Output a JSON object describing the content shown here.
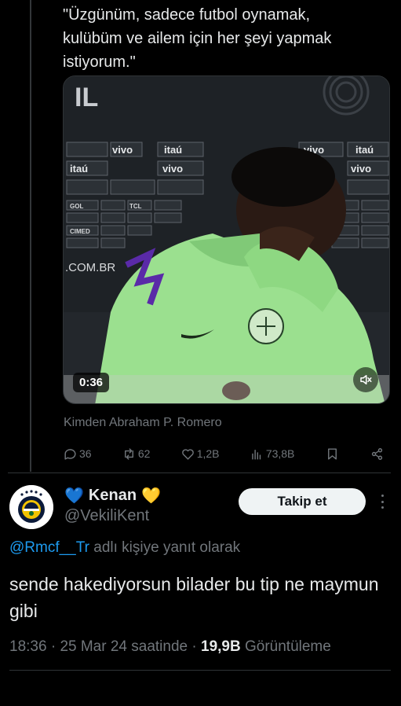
{
  "quoted": {
    "text": "\"Üzgünüm, sadece futbol oynamak,\nkulübüm ve ailem için her şeyi yapmak\nistiyorum.\"",
    "video": {
      "duration": "0:36",
      "backdrop_text": [
        "vivo",
        "itaú",
        "vivo",
        "itaú",
        "vivo",
        "itaú",
        "GOL",
        "TCL",
        "CIMED",
        ".COM.BR",
        "IL",
        "vivo",
        "itaú"
      ]
    },
    "source": "Kimden Abraham P. Romero",
    "actions": {
      "replies": "36",
      "reposts": "62",
      "likes": "1,2B",
      "views": "73,8B"
    }
  },
  "author": {
    "display_name": "Kenan",
    "emoji_left": "💙",
    "emoji_right": "💛",
    "handle": "@VekiliKent",
    "follow_label": "Takip et"
  },
  "reply_to": {
    "mention": "@Rmcf__Tr",
    "suffix": " adlı kişiye yanıt olarak"
  },
  "tweet": {
    "text": "sende hakediyorsun bilader bu tip ne maymun gibi"
  },
  "meta": {
    "time": "18:36",
    "sep1": " · ",
    "date": "25 Mar 24 saatinde",
    "sep2": " · ",
    "views": "19,9B",
    "views_label": " Görüntüleme"
  },
  "colors": {
    "background": "#000000",
    "text": "#e7e9ea",
    "muted": "#71767b",
    "link": "#1d9bf0",
    "jersey": "#9be08f"
  }
}
